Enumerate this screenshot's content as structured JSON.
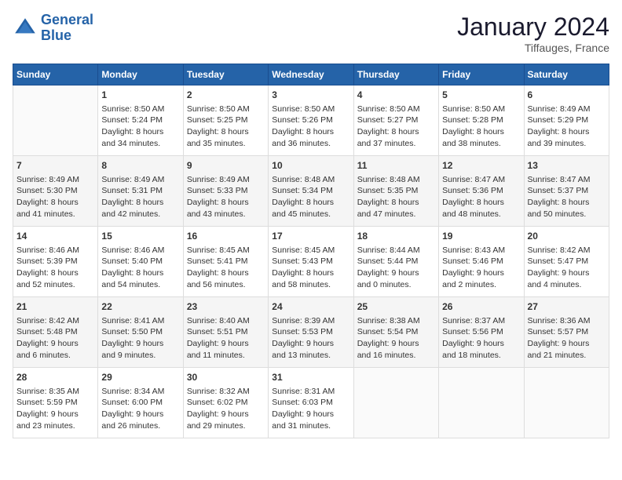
{
  "header": {
    "logo_line1": "General",
    "logo_line2": "Blue",
    "month": "January 2024",
    "location": "Tiffauges, France"
  },
  "days_of_week": [
    "Sunday",
    "Monday",
    "Tuesday",
    "Wednesday",
    "Thursday",
    "Friday",
    "Saturday"
  ],
  "weeks": [
    [
      {
        "day": "",
        "text": ""
      },
      {
        "day": "1",
        "text": "Sunrise: 8:50 AM\nSunset: 5:24 PM\nDaylight: 8 hours\nand 34 minutes."
      },
      {
        "day": "2",
        "text": "Sunrise: 8:50 AM\nSunset: 5:25 PM\nDaylight: 8 hours\nand 35 minutes."
      },
      {
        "day": "3",
        "text": "Sunrise: 8:50 AM\nSunset: 5:26 PM\nDaylight: 8 hours\nand 36 minutes."
      },
      {
        "day": "4",
        "text": "Sunrise: 8:50 AM\nSunset: 5:27 PM\nDaylight: 8 hours\nand 37 minutes."
      },
      {
        "day": "5",
        "text": "Sunrise: 8:50 AM\nSunset: 5:28 PM\nDaylight: 8 hours\nand 38 minutes."
      },
      {
        "day": "6",
        "text": "Sunrise: 8:49 AM\nSunset: 5:29 PM\nDaylight: 8 hours\nand 39 minutes."
      }
    ],
    [
      {
        "day": "7",
        "text": "Sunrise: 8:49 AM\nSunset: 5:30 PM\nDaylight: 8 hours\nand 41 minutes."
      },
      {
        "day": "8",
        "text": "Sunrise: 8:49 AM\nSunset: 5:31 PM\nDaylight: 8 hours\nand 42 minutes."
      },
      {
        "day": "9",
        "text": "Sunrise: 8:49 AM\nSunset: 5:33 PM\nDaylight: 8 hours\nand 43 minutes."
      },
      {
        "day": "10",
        "text": "Sunrise: 8:48 AM\nSunset: 5:34 PM\nDaylight: 8 hours\nand 45 minutes."
      },
      {
        "day": "11",
        "text": "Sunrise: 8:48 AM\nSunset: 5:35 PM\nDaylight: 8 hours\nand 47 minutes."
      },
      {
        "day": "12",
        "text": "Sunrise: 8:47 AM\nSunset: 5:36 PM\nDaylight: 8 hours\nand 48 minutes."
      },
      {
        "day": "13",
        "text": "Sunrise: 8:47 AM\nSunset: 5:37 PM\nDaylight: 8 hours\nand 50 minutes."
      }
    ],
    [
      {
        "day": "14",
        "text": "Sunrise: 8:46 AM\nSunset: 5:39 PM\nDaylight: 8 hours\nand 52 minutes."
      },
      {
        "day": "15",
        "text": "Sunrise: 8:46 AM\nSunset: 5:40 PM\nDaylight: 8 hours\nand 54 minutes."
      },
      {
        "day": "16",
        "text": "Sunrise: 8:45 AM\nSunset: 5:41 PM\nDaylight: 8 hours\nand 56 minutes."
      },
      {
        "day": "17",
        "text": "Sunrise: 8:45 AM\nSunset: 5:43 PM\nDaylight: 8 hours\nand 58 minutes."
      },
      {
        "day": "18",
        "text": "Sunrise: 8:44 AM\nSunset: 5:44 PM\nDaylight: 9 hours\nand 0 minutes."
      },
      {
        "day": "19",
        "text": "Sunrise: 8:43 AM\nSunset: 5:46 PM\nDaylight: 9 hours\nand 2 minutes."
      },
      {
        "day": "20",
        "text": "Sunrise: 8:42 AM\nSunset: 5:47 PM\nDaylight: 9 hours\nand 4 minutes."
      }
    ],
    [
      {
        "day": "21",
        "text": "Sunrise: 8:42 AM\nSunset: 5:48 PM\nDaylight: 9 hours\nand 6 minutes."
      },
      {
        "day": "22",
        "text": "Sunrise: 8:41 AM\nSunset: 5:50 PM\nDaylight: 9 hours\nand 9 minutes."
      },
      {
        "day": "23",
        "text": "Sunrise: 8:40 AM\nSunset: 5:51 PM\nDaylight: 9 hours\nand 11 minutes."
      },
      {
        "day": "24",
        "text": "Sunrise: 8:39 AM\nSunset: 5:53 PM\nDaylight: 9 hours\nand 13 minutes."
      },
      {
        "day": "25",
        "text": "Sunrise: 8:38 AM\nSunset: 5:54 PM\nDaylight: 9 hours\nand 16 minutes."
      },
      {
        "day": "26",
        "text": "Sunrise: 8:37 AM\nSunset: 5:56 PM\nDaylight: 9 hours\nand 18 minutes."
      },
      {
        "day": "27",
        "text": "Sunrise: 8:36 AM\nSunset: 5:57 PM\nDaylight: 9 hours\nand 21 minutes."
      }
    ],
    [
      {
        "day": "28",
        "text": "Sunrise: 8:35 AM\nSunset: 5:59 PM\nDaylight: 9 hours\nand 23 minutes."
      },
      {
        "day": "29",
        "text": "Sunrise: 8:34 AM\nSunset: 6:00 PM\nDaylight: 9 hours\nand 26 minutes."
      },
      {
        "day": "30",
        "text": "Sunrise: 8:32 AM\nSunset: 6:02 PM\nDaylight: 9 hours\nand 29 minutes."
      },
      {
        "day": "31",
        "text": "Sunrise: 8:31 AM\nSunset: 6:03 PM\nDaylight: 9 hours\nand 31 minutes."
      },
      {
        "day": "",
        "text": ""
      },
      {
        "day": "",
        "text": ""
      },
      {
        "day": "",
        "text": ""
      }
    ]
  ]
}
